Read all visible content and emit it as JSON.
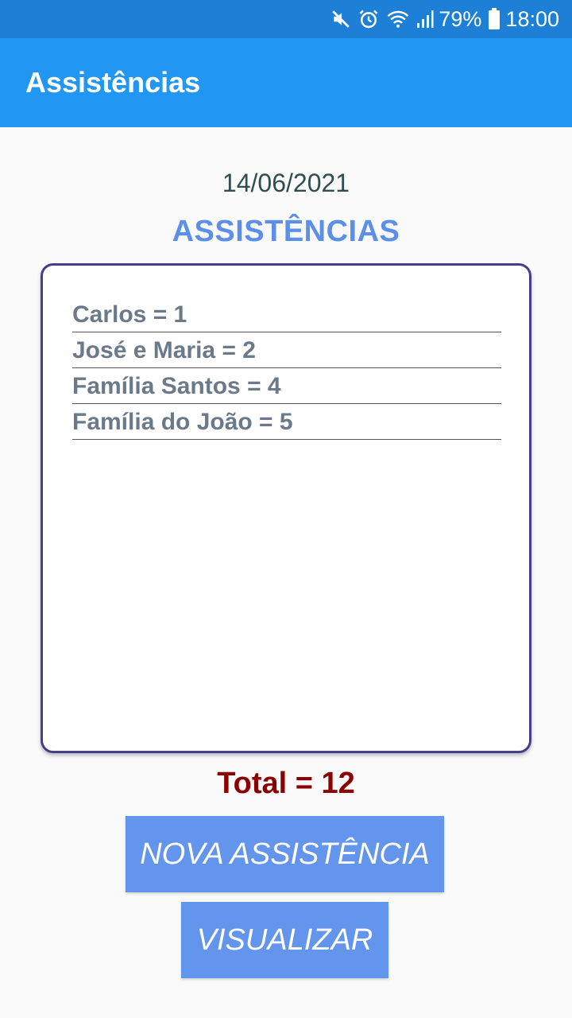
{
  "status_bar": {
    "battery_percent": "79%",
    "time": "18:00",
    "icons": [
      "mute-icon",
      "alarm-icon",
      "wifi-icon",
      "signal-icon",
      "battery-icon"
    ]
  },
  "app_bar": {
    "title": "Assistências"
  },
  "main": {
    "date": "14/06/2021",
    "heading": "ASSISTÊNCIAS",
    "items": [
      {
        "label": "Carlos = 1"
      },
      {
        "label": "José e Maria = 2"
      },
      {
        "label": "Família Santos = 4"
      },
      {
        "label": "Família do João = 5"
      }
    ],
    "total": "Total = 12"
  },
  "buttons": {
    "nova_label": "NOVA ASSISTÊNCIA",
    "visualizar_label": "VISUALIZAR"
  },
  "colors": {
    "status_bar": "#1d7fd6",
    "app_bar": "#2196f3",
    "heading": "#5b8fe8",
    "total": "#8b0000",
    "button": "#6495ed",
    "card_border": "#483d8b"
  }
}
